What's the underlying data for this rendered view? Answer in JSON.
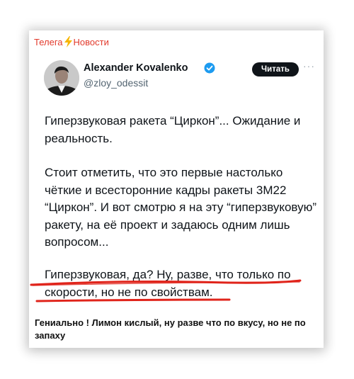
{
  "channel": {
    "name": "Телега",
    "suffix": "Новости"
  },
  "tweet": {
    "author_name": "Alexander Kovalenko",
    "handle": "@zloy_odessit",
    "follow_label": "Читать",
    "more_label": "···",
    "paragraphs": [
      "Гиперзвуковая ракета “Циркон”... Ожидание и реальность.",
      "Стоит отметить, что это первые настолько чёткие и всесторонние кадры ракеты 3М22 “Циркон”. И вот смотрю я на эту “гиперзвуковую” ракету, на её проект и задаюсь одним лишь вопросом...",
      "Гиперзвуковая, да? Ну, разве, что только по скорости, но не по свойствам."
    ]
  },
  "caption": "Гениально ! Лимон кислый, ну разве что по вкусу, но не по запаху",
  "colors": {
    "channel": "#e23a2c",
    "bolt": "#f7b500",
    "underline": "#e0241b",
    "verified": "#1d9bf0",
    "follow_bg": "#0f1419"
  },
  "icons": [
    "lightning-icon",
    "verified-badge-icon",
    "more-options-icon"
  ]
}
